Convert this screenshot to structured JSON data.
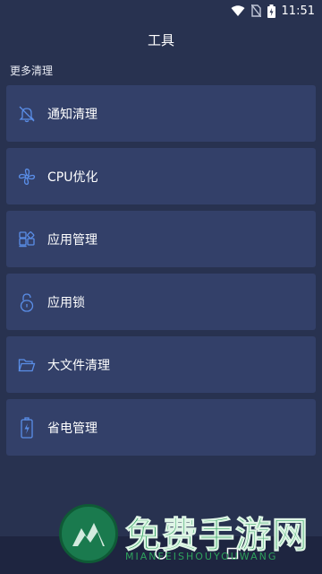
{
  "status_bar": {
    "time": "11:51"
  },
  "header": {
    "title": "工具"
  },
  "section": {
    "label": "更多清理"
  },
  "menu": [
    {
      "label": "通知清理",
      "icon": "bell-off-icon"
    },
    {
      "label": "CPU优化",
      "icon": "fan-icon"
    },
    {
      "label": "应用管理",
      "icon": "apps-grid-icon"
    },
    {
      "label": "应用锁",
      "icon": "lock-icon"
    },
    {
      "label": "大文件清理",
      "icon": "folder-icon"
    },
    {
      "label": "省电管理",
      "icon": "battery-icon"
    }
  ],
  "watermark": {
    "title": "免费手游网",
    "subtitle": "MIANFEISHOUYOUWANG"
  },
  "colors": {
    "background": "#283250",
    "card": "#334069",
    "icon_accent": "#5a8ee8",
    "watermark_green": "#2ea15c"
  }
}
